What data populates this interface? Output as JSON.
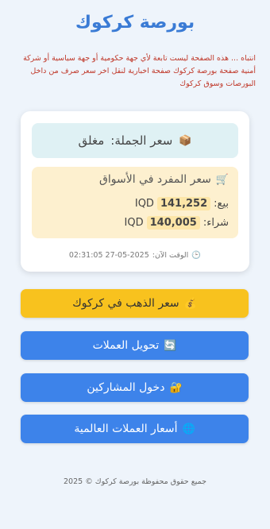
{
  "header": {
    "title": "بورصة كركوك"
  },
  "notice": {
    "text": "انتباه ... هذه الصفحة ليست تابعة لأي جهة حكومية أو جهة سياسية أو شركة أمنية صفحة بورصة كركوك صفحة اخبارية لنقل اخر سعر صرف من داخل البورصات وسوق كركوك"
  },
  "card": {
    "wholesale": {
      "icon": "📦",
      "label": "سعر الجملة:",
      "value": "مغلق"
    },
    "retail": {
      "icon": "🛒",
      "label": "سعر المفرد في الأسواق",
      "buy_label": "بيع:",
      "buy_value": "141,252",
      "sell_label": "شراء:",
      "sell_value": "140,005",
      "currency": "IQD"
    },
    "time": {
      "icon": "🕒",
      "label": "الوقت الآن:",
      "value": "02:31:05 27-05-2025"
    }
  },
  "buttons": {
    "gold": {
      "icon": "💰",
      "label": "سعر الذهب في كركوك"
    },
    "exchange": {
      "icon": "🔄",
      "label": "تحويل العملات"
    },
    "members": {
      "icon": "🔐",
      "label": "دخول المشاركين"
    },
    "world": {
      "icon": "🌐",
      "label": "أسعار العملات العالمية"
    }
  },
  "footer": {
    "text": "جميع حقوق محفوظة بورصة كركوك © 2025"
  },
  "colors": {
    "accent": "#3a7bd5",
    "gold_button": "#f8c21e",
    "blue_button": "#3d83ea",
    "warning": "#c0392b"
  }
}
